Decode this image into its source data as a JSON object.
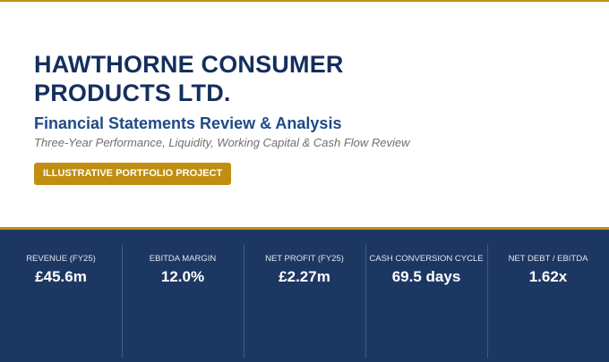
{
  "cover": {
    "title": "HAWTHORNE CONSUMER PRODUCTS LTD.",
    "subtitle": "Financial Statements Review & Analysis",
    "tagline": "Three-Year Performance, Liquidity, Working Capital & Cash Flow Review",
    "badge": "ILLUSTRATIVE PORTFOLIO PROJECT"
  },
  "kpis": [
    {
      "label": "REVENUE (FY25)",
      "value": "£45.6m"
    },
    {
      "label": "EBITDA MARGIN",
      "value": "12.0%"
    },
    {
      "label": "NET PROFIT (FY25)",
      "value": "£2.27m"
    },
    {
      "label": "CASH CONVERSION CYCLE",
      "value": "69.5 days"
    },
    {
      "label": "NET DEBT / EBITDA",
      "value": "1.62x"
    }
  ],
  "colors": {
    "accent_gold": "#c08f12",
    "navy": "#1d3763",
    "title_navy": "#142e5e",
    "subtitle_blue": "#1f4a87"
  }
}
